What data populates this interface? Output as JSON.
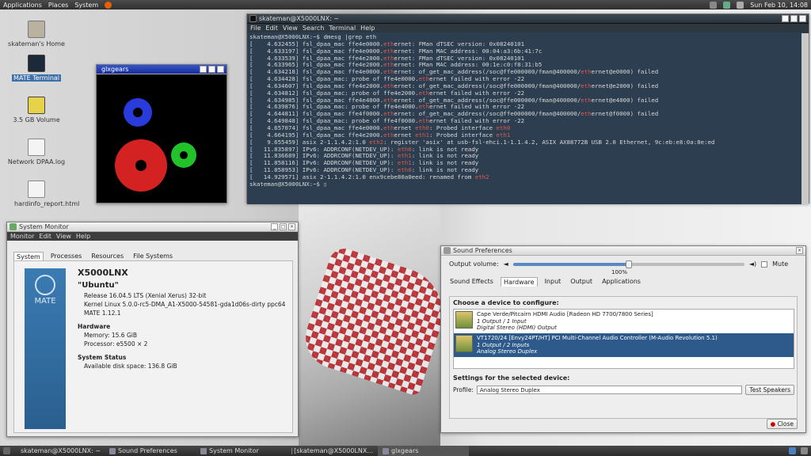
{
  "top_panel": {
    "menus": [
      "Applications",
      "Places",
      "System"
    ],
    "clock": "Sun Feb 10, 14:08"
  },
  "desktop_icons": [
    {
      "label": "skateman's Home"
    },
    {
      "label": "MATE Terminal"
    },
    {
      "label": "3.5 GB Volume"
    },
    {
      "label": "Network DPAA.log"
    },
    {
      "label": "hardinfo_report.html"
    }
  ],
  "terminal": {
    "title": "skateman@X5000LNX: ~",
    "menus": [
      "File",
      "Edit",
      "View",
      "Search",
      "Terminal",
      "Help"
    ],
    "lines": [
      "skateman@X5000LNX:~$ dmesg |grep eth",
      "[    4.632455] fsl_dpaa_mac ffe4e0000.ethernet: FMan dTSEC version: 0x08240101",
      "[    4.633197] fsl_dpaa_mac ffe4e0000.ethernet: FMan MAC address: 00:04:a3:6b:41:7c",
      "[    4.633539] fsl_dpaa_mac ffe4e2000.ethernet: FMan dTSEC version: 0x08240101",
      "[    4.633965] fsl_dpaa_mac ffe4e2000.ethernet: FMan MAC address: 00:1e:c0:f8:31:b5",
      "[    4.634218] fsl_dpaa_mac ffe4e0000.ethernet: of_get_mac_address(/soc@ffe000000/fman@400000/ethernet@e0000) failed",
      "[    4.634428] fsl_dpaa_mac: probe of ffe4e0000.ethernet failed with error -22",
      "[    4.634607] fsl_dpaa_mac ffe4e2000.ethernet: of_get_mac_address(/soc@ffe000000/fman@400000/ethernet@e2000) failed",
      "[    4.634812] fsl_dpaa_mac: probe of ffe4e2000.ethernet failed with error -22",
      "[    4.634985] fsl_dpaa_mac ffe4e4000.ethernet: of_get_mac_address(/soc@ffe000000/fman@400000/ethernet@e4000) failed",
      "[    4.639876] fsl_dpaa_mac: probe of ffe4e4000.ethernet failed with error -22",
      "[    4.644811] fsl_dpaa_mac ffe4f0000.ethernet: of_get_mac_address(/soc@ffe000000/fman@400000/ethernet@f0000) failed",
      "[    4.649848] fsl_dpaa_mac: probe of ffe4f0000.ethernet failed with error -22",
      "[    4.657074] fsl_dpaa_mac ffe4e0000.ethernet eth0: Probed interface eth0",
      "[    4.664195] fsl_dpaa_mac ffe4e2000.ethernet eth1: Probed interface eth1",
      "[    9.655459] asix 2-1.1.4.2:1.0 eth2: register 'asix' at usb-fsl-ehci.1-1.1.4.2, ASIX AX88772B USB 2.0 Ethernet, 9c:eb:e8:0a:8e:ed",
      "[   11.835897] IPv6: ADDRCONF(NETDEV_UP): eth0: link is not ready",
      "[   11.836689] IPv6: ADDRCONF(NETDEV_UP): eth1: link is not ready",
      "[   11.858116] IPv6: ADDRCONF(NETDEV_UP): eth1: link is not ready",
      "[   11.858953] IPv6: ADDRCONF(NETDEV_UP): eth0: link is not ready",
      "[   14.929571] asix 2-1.1.4.2:1.0 enx9cebe80a0eed: renamed from eth2",
      "skateman@X5000LNX:~$ "
    ]
  },
  "glxgears": {
    "title": "glxgears",
    "gear_colors": [
      "#2a3bdc",
      "#d42222",
      "#22c22a"
    ]
  },
  "sysmon": {
    "title": "System Monitor",
    "menus": [
      "Monitor",
      "Edit",
      "View",
      "Help"
    ],
    "tabs": [
      "System",
      "Processes",
      "Resources",
      "File Systems"
    ],
    "logo_text": "MATE",
    "hostname": "X5000LNX",
    "distro": "\"Ubuntu\"",
    "release": "Release 16.04.5 LTS (Xenial Xerus) 32-bit",
    "kernel": "Kernel Linux 5.0.0-rc5-DMA_A1-X5000-54581-gda1d06s-dirty ppc64",
    "mate": "MATE 1.12.1",
    "hardware_h": "Hardware",
    "memory": "Memory:      15.6 GiB",
    "processor": "Processor:   e5500 × 2",
    "status_h": "System Status",
    "disk": "Available disk space:   136.8 GiB"
  },
  "sound": {
    "title": "Sound Preferences",
    "output_label": "Output volume:",
    "volume_percent": 100,
    "volume_text": "100%",
    "mute_label": "Mute",
    "tabs": [
      "Sound Effects",
      "Hardware",
      "Input",
      "Output",
      "Applications"
    ],
    "choose_label": "Choose a device to configure:",
    "devices": [
      {
        "name": "Cape Verde/Pitcairn HDMI Audio [Radeon HD 7700/7800 Series]",
        "io": "1 Output / 1 Input",
        "profile": "Digital Stereo (HDMI) Output"
      },
      {
        "name": "VT1720/24 [Envy24PT/HT] PCI Multi-Channel Audio Controller (M-Audio Revolution 5.1)",
        "io": "1 Output / 2 Inputs",
        "profile": "Analog Stereo Duplex"
      }
    ],
    "settings_label": "Settings for the selected device:",
    "profile_label": "Profile:",
    "profile_value": "Analog Stereo Duplex",
    "test_label": "Test Speakers",
    "close_label": "Close"
  },
  "taskbar": [
    {
      "label": "skateman@X5000LNX: ~"
    },
    {
      "label": "Sound Preferences"
    },
    {
      "label": "System Monitor"
    },
    {
      "label": "[skateman@X5000LNX..."
    },
    {
      "label": "glxgears"
    }
  ]
}
